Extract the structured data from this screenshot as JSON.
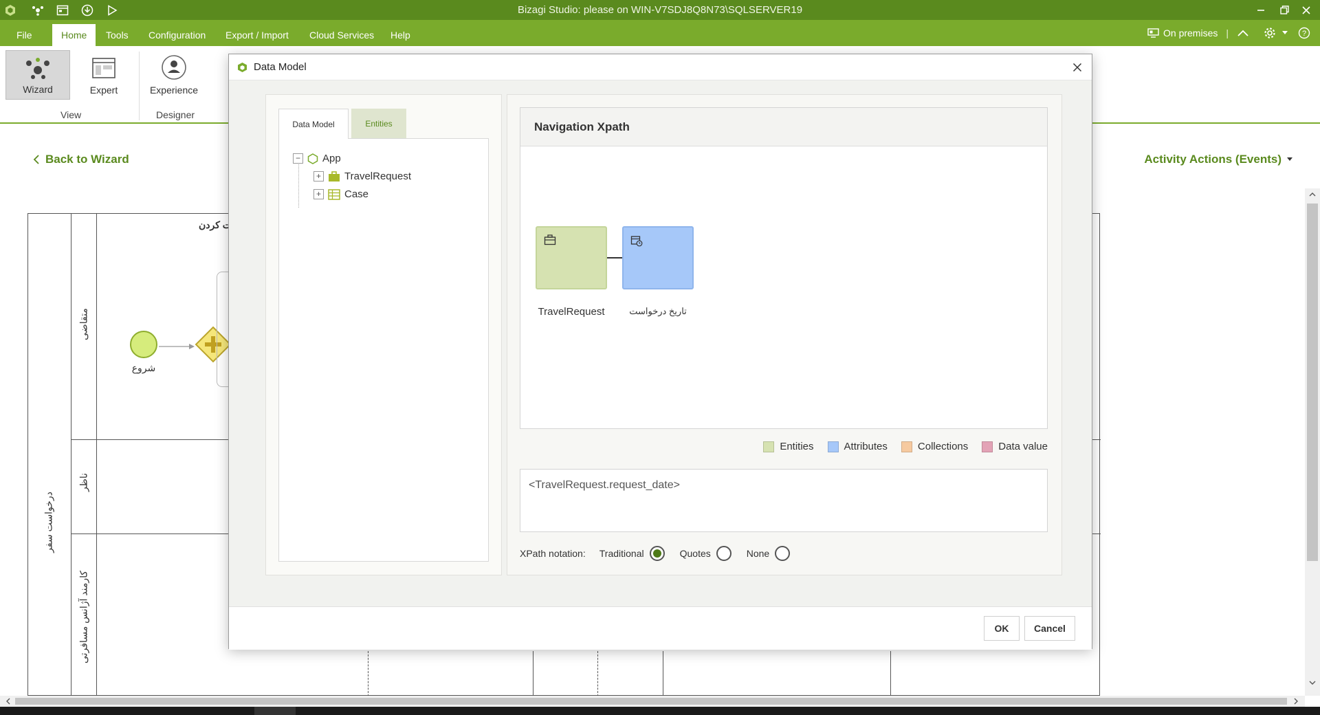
{
  "app": {
    "title": "Bizagi Studio: please  on WIN-V7SDJ8Q8N73\\SQLSERVER19"
  },
  "menu": {
    "items": [
      "File",
      "Home",
      "Tools",
      "Configuration",
      "Export / Import",
      "Cloud Services",
      "Help"
    ],
    "active": "Home",
    "environment": "On premises"
  },
  "ribbon": {
    "buttons": [
      {
        "label": "Wizard",
        "icon": "wizard-icon",
        "active": true
      },
      {
        "label": "Expert",
        "icon": "expert-icon",
        "active": false
      },
      {
        "label": "Experience",
        "icon": "experience-icon",
        "active": false
      }
    ],
    "groups": [
      "View",
      "Designer"
    ]
  },
  "workspace": {
    "back_link": "Back to Wizard",
    "activity_actions": "Activity Actions (Events)",
    "pool_name": "درخواست سفر",
    "lanes": [
      "متقاضی",
      "ناظر",
      "کارمند آژانس مسافرتی"
    ],
    "start_event_label": "شروع",
    "task_label_partial": "ت کردن"
  },
  "dialog": {
    "title": "Data Model",
    "tabs": [
      "Data Model",
      "Entities"
    ],
    "active_tab": "Data Model",
    "tree": {
      "root": "App",
      "children": [
        "TravelRequest",
        "Case"
      ]
    },
    "navigation": {
      "heading": "Navigation Xpath",
      "nodes": [
        {
          "label": "TravelRequest",
          "type": "entity",
          "color": "#d6e2b1"
        },
        {
          "label": "تاریخ درخواست",
          "type": "attribute",
          "color": "#a6c8f9"
        }
      ]
    },
    "legend": [
      {
        "label": "Entities",
        "color": "#d6e2b1"
      },
      {
        "label": "Attributes",
        "color": "#a6c8f9"
      },
      {
        "label": "Collections",
        "color": "#f6caa0"
      },
      {
        "label": "Data value",
        "color": "#e3a3b6"
      }
    ],
    "xpath_value": "<TravelRequest.request_date>",
    "notation": {
      "label": "XPath notation:",
      "options": [
        "Traditional",
        "Quotes",
        "None"
      ],
      "selected": "Traditional"
    },
    "buttons": {
      "ok": "OK",
      "cancel": "Cancel"
    }
  },
  "colors": {
    "brand": "#7aab2c",
    "titlebar": "#5a8a1e",
    "accent_text": "#5a8a1e"
  }
}
